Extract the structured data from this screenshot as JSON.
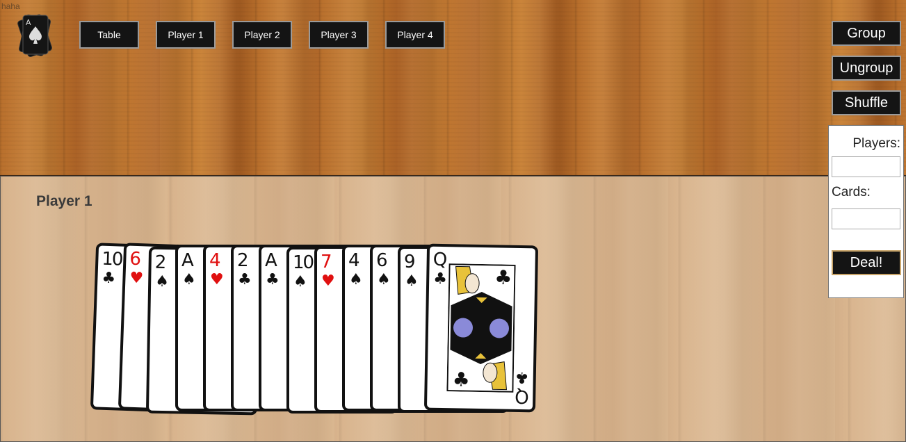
{
  "debug_text": "haha",
  "logo": {
    "icon": "ace-of-spades-logo-icon",
    "rank": "A",
    "suit": "♠"
  },
  "nav": [
    {
      "label": "Table"
    },
    {
      "label": "Player 1"
    },
    {
      "label": "Player 2"
    },
    {
      "label": "Player 3"
    },
    {
      "label": "Player 4"
    }
  ],
  "actions": {
    "group": "Group",
    "ungroup": "Ungroup",
    "shuffle": "Shuffle"
  },
  "deal_panel": {
    "players_label": "Players:",
    "players_value": "",
    "cards_label": "Cards:",
    "cards_value": "",
    "deal_button": "Deal!"
  },
  "hand": {
    "title": "Player 1",
    "cards": [
      {
        "rank": "10",
        "suit": "♣",
        "color": "black"
      },
      {
        "rank": "6",
        "suit": "♥",
        "color": "red"
      },
      {
        "rank": "2",
        "suit": "♠",
        "color": "black"
      },
      {
        "rank": "A",
        "suit": "♠",
        "color": "black"
      },
      {
        "rank": "4",
        "suit": "♥",
        "color": "red"
      },
      {
        "rank": "2",
        "suit": "♣",
        "color": "black"
      },
      {
        "rank": "A",
        "suit": "♣",
        "color": "black"
      },
      {
        "rank": "10",
        "suit": "♠",
        "color": "black"
      },
      {
        "rank": "7",
        "suit": "♥",
        "color": "red"
      },
      {
        "rank": "4",
        "suit": "♠",
        "color": "black"
      },
      {
        "rank": "6",
        "suit": "♠",
        "color": "black"
      },
      {
        "rank": "9",
        "suit": "♠",
        "color": "black"
      },
      {
        "rank": "Q",
        "suit": "♣",
        "color": "black",
        "face": true
      }
    ]
  },
  "colors": {
    "button_bg": "#141414",
    "button_border": "#9a9a9a",
    "deal_border": "#c9a56a",
    "red_suit": "#e01010"
  }
}
